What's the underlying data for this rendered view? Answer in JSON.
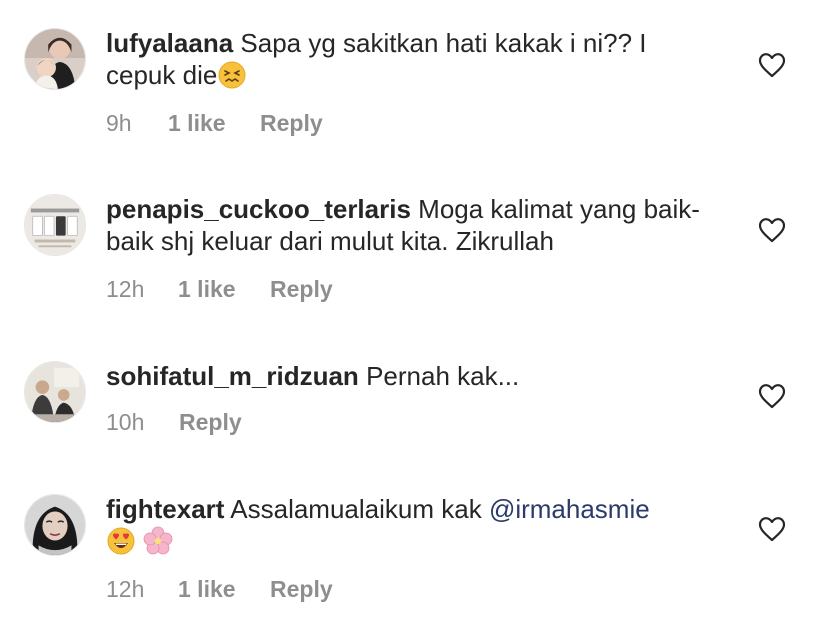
{
  "comments": [
    {
      "username": "lufyalaana",
      "text": "Sapa yg sakitkan hati kakak i ni?? I cepuk die",
      "emoji": "confounded-face-icon",
      "time": "9h",
      "likes": "1 like",
      "reply": "Reply",
      "avatar": "woman-with-baby-avatar"
    },
    {
      "username": "penapis_cuckoo_terlaris",
      "text": "Moga kalimat yang baik-baik shj keluar dari mulut kita. Zikrullah",
      "time": "12h",
      "likes": "1 like",
      "reply": "Reply",
      "avatar": "water-filter-product-avatar"
    },
    {
      "username": "sohifatul_m_ridzuan",
      "text": "Pernah kak...",
      "time": "10h",
      "reply": "Reply",
      "avatar": "group-photo-avatar"
    },
    {
      "username": "fightexart",
      "text": "Assalamualaikum kak",
      "mention": "@irmahasmie",
      "emojis": [
        "heart-eyes-face-icon",
        "cherry-blossom-icon"
      ],
      "time": "12h",
      "likes": "1 like",
      "reply": "Reply",
      "avatar": "hijab-woman-avatar"
    }
  ],
  "colors": {
    "text": "#262626",
    "meta": "#8e8e8e",
    "mention": "#2b3a6b",
    "heart_outline": "#262626"
  }
}
